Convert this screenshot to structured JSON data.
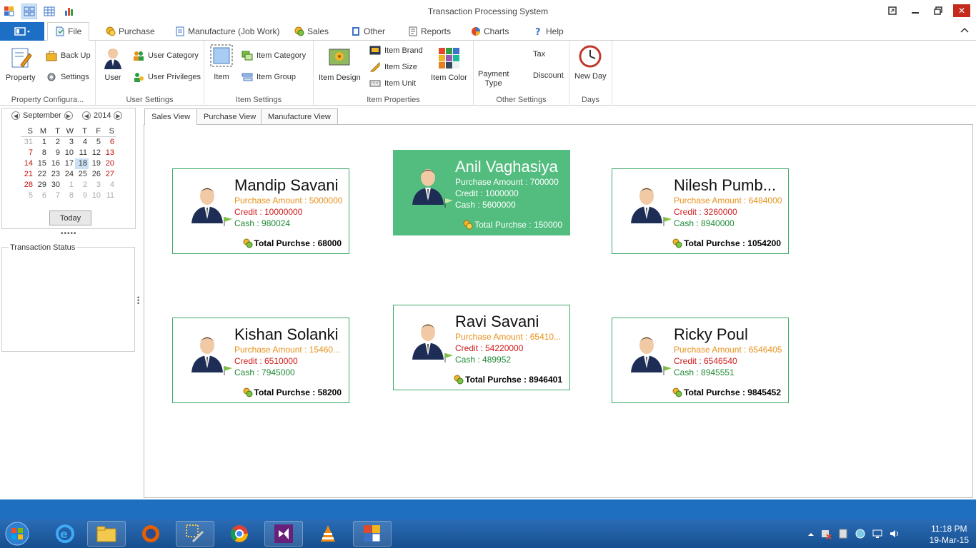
{
  "window": {
    "title": "Transaction Processing System"
  },
  "tabs": [
    {
      "label": "File"
    },
    {
      "label": "Purchase"
    },
    {
      "label": "Manufacture (Job Work)"
    },
    {
      "label": "Sales"
    },
    {
      "label": "Other"
    },
    {
      "label": "Reports"
    },
    {
      "label": "Charts"
    },
    {
      "label": "Help"
    }
  ],
  "ribbon": {
    "property_config": {
      "label": "Property Configura...",
      "property": "Property",
      "backup": "Back Up",
      "settings": "Settings"
    },
    "user_settings": {
      "label": "User Settings",
      "user": "User",
      "user_category": "User Category",
      "user_privileges": "User Privileges"
    },
    "item_settings": {
      "label": "Item Settings",
      "item": "Item",
      "item_category": "Item Category",
      "item_group": "Item Group"
    },
    "item_properties": {
      "label": "Item Properties",
      "item_design": "Item Design",
      "item_brand": "Item Brand",
      "item_size": "Item Size",
      "item_unit": "Item Unit",
      "item_color": "Item Color"
    },
    "other_settings": {
      "label": "Other Settings",
      "payment_type": "Payment\nType",
      "tax": "Tax",
      "discount": "Discount"
    },
    "days": {
      "label": "Days",
      "new_day": "New Day"
    }
  },
  "calendar": {
    "month": "September",
    "year": "2014",
    "dow": [
      "S",
      "M",
      "T",
      "W",
      "T",
      "F",
      "S"
    ],
    "weeks": [
      [
        "31",
        "1",
        "2",
        "3",
        "4",
        "5",
        "6"
      ],
      [
        "7",
        "8",
        "9",
        "10",
        "11",
        "12",
        "13"
      ],
      [
        "14",
        "15",
        "16",
        "17",
        "18",
        "19",
        "20"
      ],
      [
        "21",
        "22",
        "23",
        "24",
        "25",
        "26",
        "27"
      ],
      [
        "28",
        "29",
        "30",
        "1",
        "2",
        "3",
        "4"
      ],
      [
        "5",
        "6",
        "7",
        "8",
        "9",
        "10",
        "11"
      ]
    ],
    "today_label": "Today"
  },
  "transaction_status": {
    "label": "Transaction Status"
  },
  "view_tabs": [
    {
      "label": "Sales View"
    },
    {
      "label": "Purchase View"
    },
    {
      "label": "Manufacture View"
    }
  ],
  "cards": [
    {
      "name": "Mandip Savani",
      "purchase": "Purchase Amount : 5000000",
      "credit": "Credit : 10000000",
      "cash": "Cash : 980024",
      "total": "Total Purchse : 68000"
    },
    {
      "name": "Anil Vaghasiya",
      "purchase": "Purchase Amount : 700000",
      "credit": "Credit : 1000000",
      "cash": "Cash : 5600000",
      "total": "Total Purchse : 150000"
    },
    {
      "name": "Nilesh Pumb...",
      "purchase": "Purchase Amount : 6484000",
      "credit": "Credit : 3260000",
      "cash": "Cash : 8940000",
      "total": "Total Purchse : 1054200"
    },
    {
      "name": "Kishan Solanki",
      "purchase": "Purchase Amount : 15460...",
      "credit": "Credit : 6510000",
      "cash": "Cash : 7945000",
      "total": "Total Purchse : 58200"
    },
    {
      "name": "Ravi Savani",
      "purchase": "Purchase Amount : 65410...",
      "credit": "Credit : 54220000",
      "cash": "Cash : 489952",
      "total": "Total Purchse : 8946401"
    },
    {
      "name": "Ricky Poul",
      "purchase": "Purchase Amount : 6546405",
      "credit": "Credit : 6546540",
      "cash": "Cash : 8945551",
      "total": "Total Purchse : 9845452"
    }
  ],
  "taskbar": {
    "time": "11:18 PM",
    "date": "19-Mar-15"
  },
  "colors": {
    "accent": "#1c6fc4",
    "card_border": "#3ba866",
    "card_selected": "#52bd7e",
    "purchase": "#e8901a",
    "credit": "#d01a1a",
    "cash": "#1f8a34"
  }
}
